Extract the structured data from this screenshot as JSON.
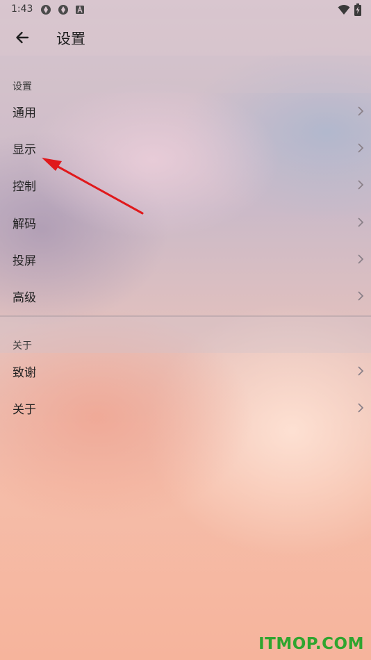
{
  "status_bar": {
    "time": "1:43",
    "icons": [
      "sync-icon",
      "sync-icon",
      "a-letter-icon"
    ],
    "right_icons": [
      "wifi-icon",
      "battery-charging-icon"
    ]
  },
  "app_bar": {
    "back_icon": "arrow-left-icon",
    "title": "设置"
  },
  "sections": [
    {
      "header": "设置",
      "items": [
        {
          "label": "通用"
        },
        {
          "label": "显示"
        },
        {
          "label": "控制"
        },
        {
          "label": "解码"
        },
        {
          "label": "投屏"
        },
        {
          "label": "高级"
        }
      ]
    },
    {
      "header": "关于",
      "items": [
        {
          "label": "致谢"
        },
        {
          "label": "关于"
        }
      ]
    }
  ],
  "watermark": "ITMOP.COM",
  "colors": {
    "annotation_arrow": "#e0191c",
    "watermark": "#2fa52f"
  }
}
